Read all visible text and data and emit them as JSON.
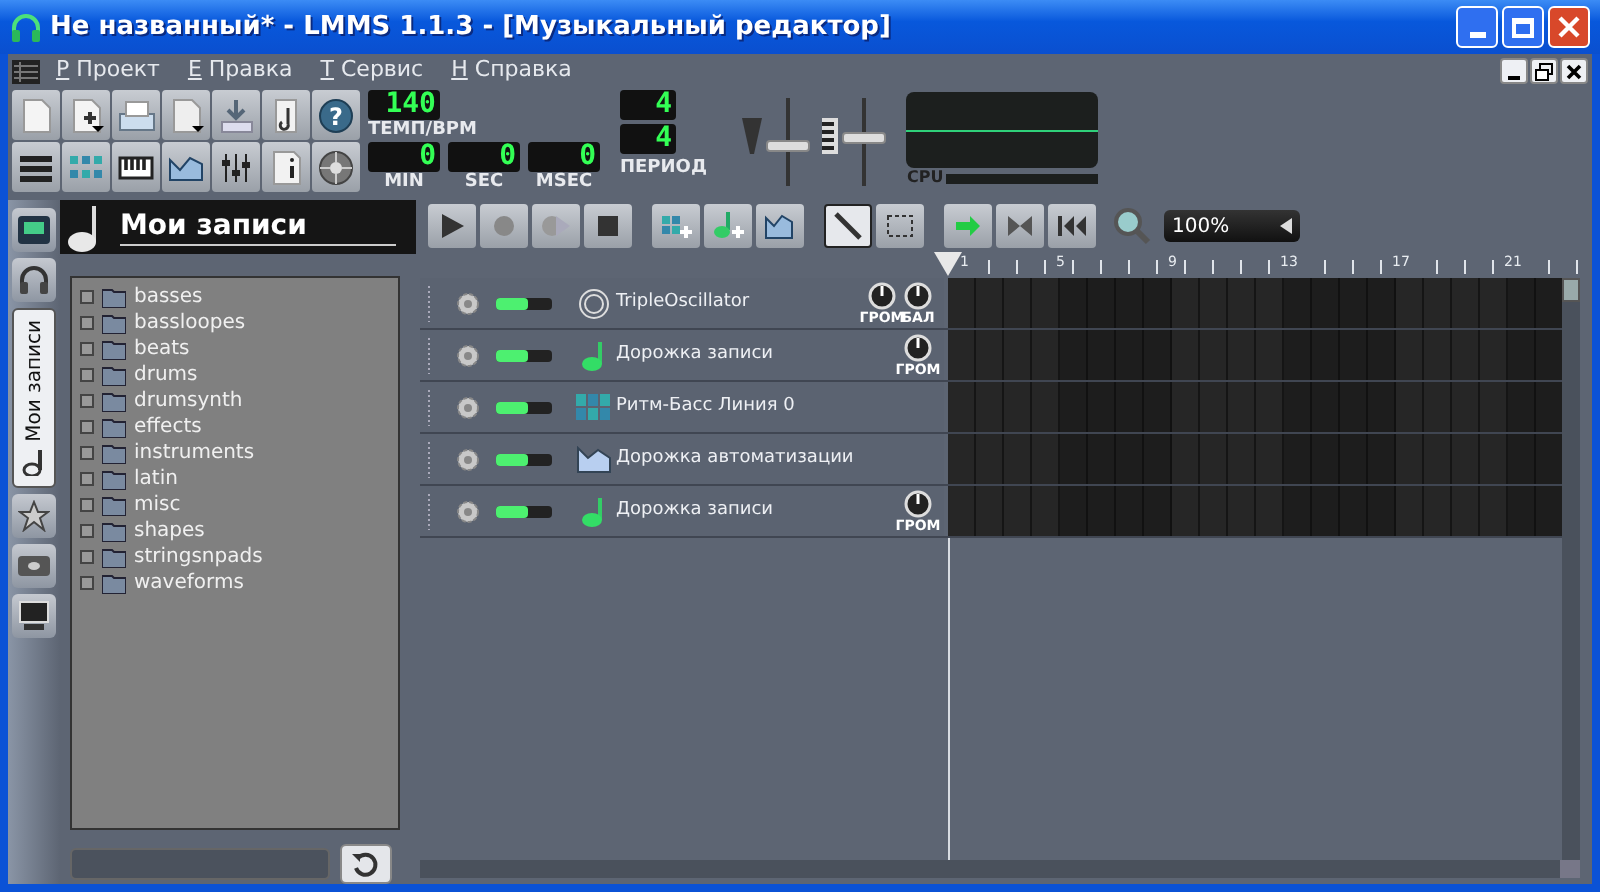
{
  "window": {
    "title": "Не названный* - LMMS 1.1.3 - [Музыкальный редактор]"
  },
  "menu": [
    {
      "key": "P",
      "label": "Проект"
    },
    {
      "key": "E",
      "label": "Правка"
    },
    {
      "key": "T",
      "label": "Сервис"
    },
    {
      "key": "H",
      "label": "Справка"
    }
  ],
  "tempo": {
    "value": "140",
    "label": "ТЕМП/BPM"
  },
  "time": [
    {
      "value": "0",
      "label": "MIN"
    },
    {
      "value": "0",
      "label": "SEC"
    },
    {
      "value": "0",
      "label": "MSEC"
    }
  ],
  "time_signature": {
    "numerator": "4",
    "denominator": "4",
    "label": "ПЕРИОД"
  },
  "master_volume": {
    "level": 0.45
  },
  "master_pitch": {
    "level": 0.55
  },
  "help_button": {
    "glyph": "?"
  },
  "cpu": {
    "label": "CPU"
  },
  "side_tabs": [
    {
      "kind": "instrument",
      "selected": false
    },
    {
      "kind": "headphones",
      "selected": false
    },
    {
      "kind": "folder",
      "label": "Мои записи",
      "selected": true
    },
    {
      "kind": "star",
      "selected": false
    },
    {
      "kind": "drive",
      "selected": false
    },
    {
      "kind": "computer",
      "selected": false
    }
  ],
  "browser": {
    "title": "Мои записи",
    "folders": [
      "basses",
      "bassloopes",
      "beats",
      "drums",
      "drumsynth",
      "effects",
      "instruments",
      "latin",
      "misc",
      "shapes",
      "stringsnpads",
      "waveforms"
    ]
  },
  "song_editor": {
    "zoom": "100%",
    "ruler": [
      "1",
      "5",
      "9",
      "13",
      "17",
      "21"
    ],
    "tracks": [
      {
        "kind": "synth",
        "name": "TripleOscillator",
        "muted": false,
        "knobs": [
          "ГРОМ",
          "БАЛ"
        ]
      },
      {
        "kind": "sample",
        "name": "Дорожка записи",
        "muted": false,
        "knobs": [
          "ГРОМ"
        ]
      },
      {
        "kind": "beat",
        "name": "Ритм-Басс Линия 0",
        "muted": false
      },
      {
        "kind": "automation",
        "name": "Дорожка автоматизации",
        "muted": false
      },
      {
        "kind": "sample",
        "name": "Дорожка записи",
        "muted": false,
        "knobs": [
          "ГРОМ"
        ]
      }
    ]
  }
}
